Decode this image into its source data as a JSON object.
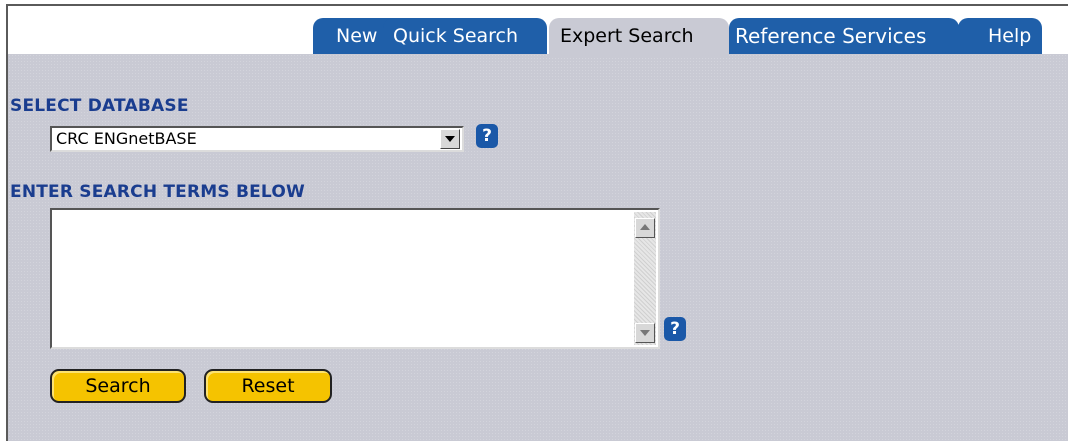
{
  "tabs": [
    {
      "label": "New"
    },
    {
      "label": "Quick Search"
    },
    {
      "label": "Expert Search",
      "active": true
    },
    {
      "label": "Reference Services"
    },
    {
      "label": "Help"
    }
  ],
  "database": {
    "section_label": "SELECT DATABASE",
    "selected": "CRC ENGnetBASE",
    "help_label": "?"
  },
  "search_terms": {
    "section_label": "ENTER SEARCH TERMS BELOW",
    "value": "",
    "help_label": "?"
  },
  "buttons": {
    "search": "Search",
    "reset": "Reset"
  },
  "colors": {
    "tab_blue": "#1f5fa9",
    "panel_gray": "#c9cad4",
    "label_blue": "#1a3d8f",
    "button_yellow": "#f5c300"
  }
}
